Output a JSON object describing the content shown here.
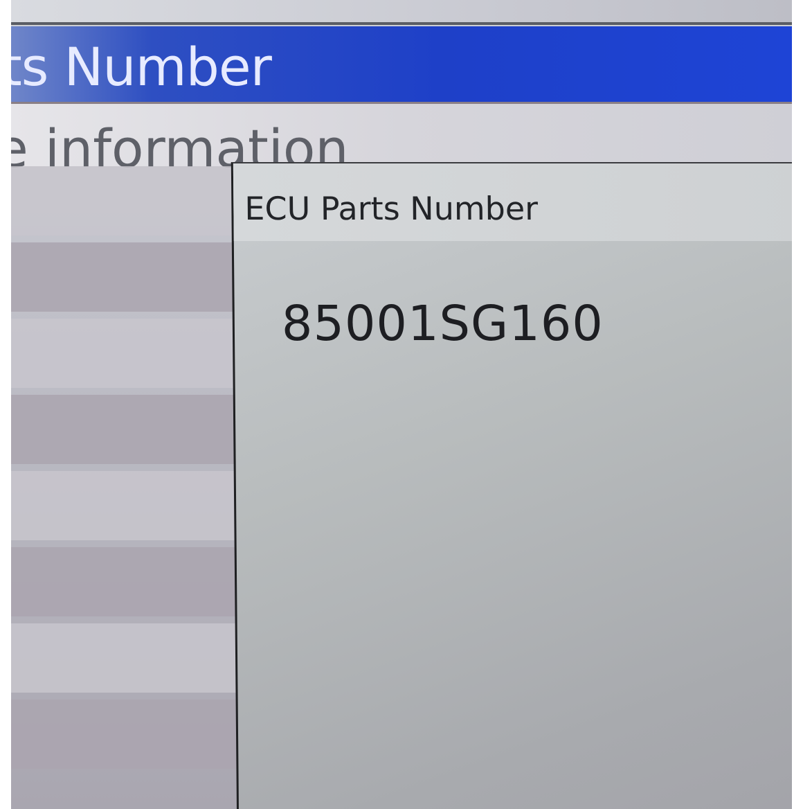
{
  "background_window": {
    "title": "ts Number",
    "section_label": "e information",
    "accent_color": "#1e40c8"
  },
  "dialog": {
    "title": "ECU Parts Number",
    "part_number": "85001SG160"
  }
}
